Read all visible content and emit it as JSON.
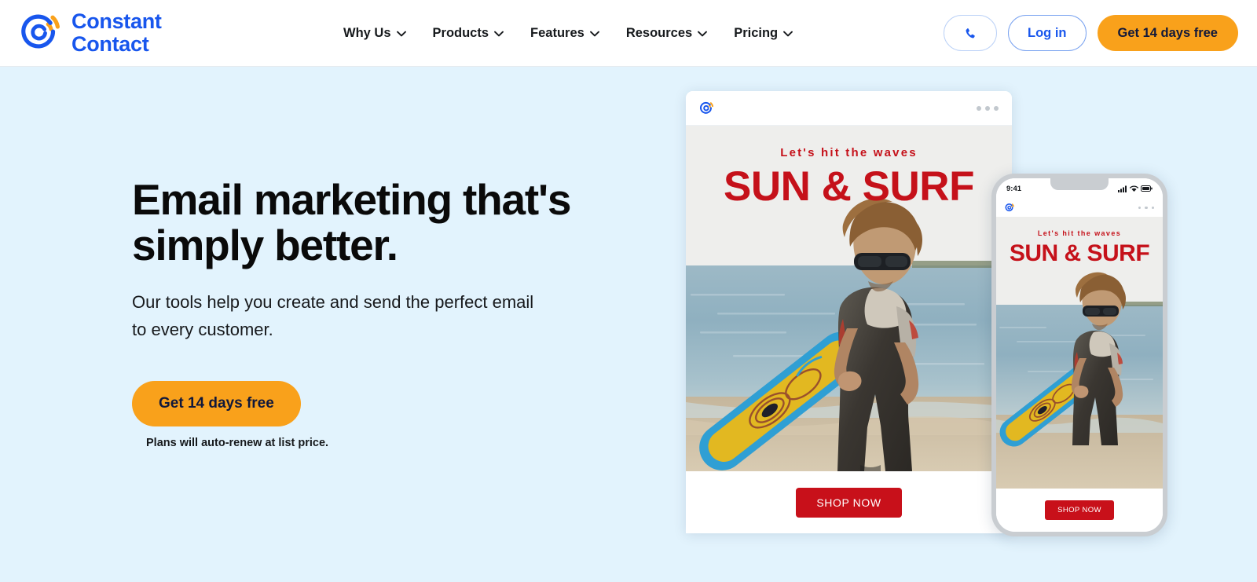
{
  "header": {
    "logo": {
      "name": "constant-contact-logo",
      "text": "Constant\nContact"
    },
    "nav": [
      {
        "label": "Why Us"
      },
      {
        "label": "Products"
      },
      {
        "label": "Features"
      },
      {
        "label": "Resources"
      },
      {
        "label": "Pricing"
      }
    ],
    "actions": {
      "phone_icon": "phone-icon",
      "login_label": "Log in",
      "trial_label": "Get 14 days free"
    }
  },
  "hero": {
    "title": "Email marketing that's\nsimply better.",
    "subtitle": "Our tools help you create and send the perfect email to every customer.",
    "cta_label": "Get 14 days free",
    "note": "Plans will auto-renew at list price.",
    "background_color": "#e2f3fd"
  },
  "desktop_mockup": {
    "logo_icon": "constant-contact-mark-icon",
    "menu_icon": "more-dots-icon",
    "email": {
      "kicker": "Let's hit the waves",
      "headline": "SUN & SURF",
      "button_label": "SHOP NOW",
      "accent_color": "#c5111a"
    }
  },
  "phone_mockup": {
    "status": {
      "time": "9:41",
      "signal_icon": "signal-bars-icon",
      "wifi_icon": "wifi-icon",
      "battery_icon": "battery-icon"
    },
    "logo_icon": "constant-contact-mark-icon",
    "menu_icon": "more-dots-icon",
    "email": {
      "kicker": "Let's hit the waves",
      "headline": "SUN & SURF",
      "button_label": "SHOP NOW",
      "accent_color": "#c5111a"
    }
  },
  "colors": {
    "brand_blue": "#1856ed",
    "brand_orange": "#f9a11b",
    "hero_bg": "#e2f3fd",
    "email_red": "#c8101a"
  }
}
